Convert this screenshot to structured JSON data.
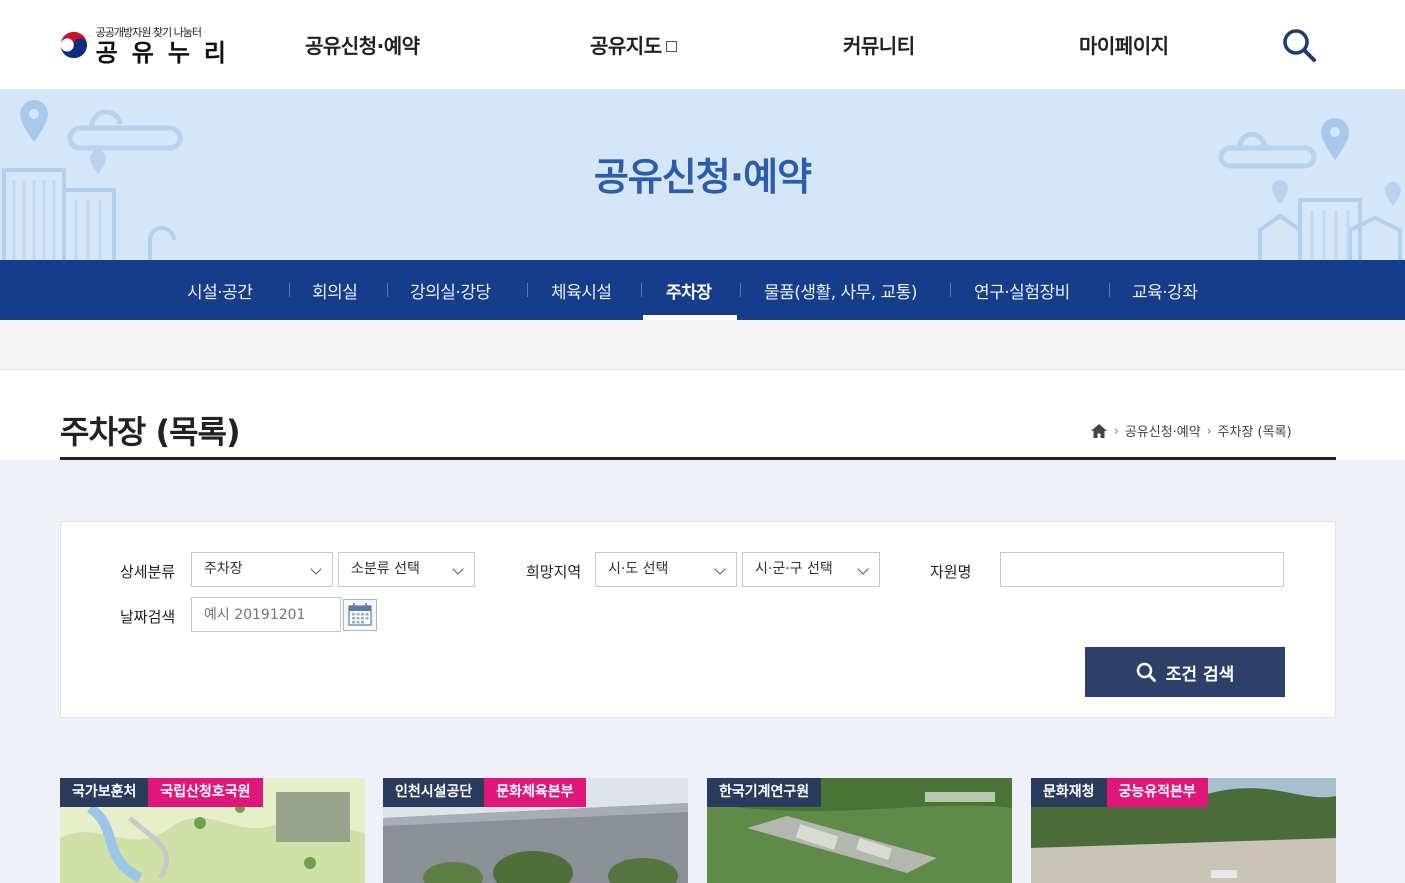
{
  "header": {
    "logo_sub": "공공개방자원 찾기 나눔터",
    "logo_main": "공유누리",
    "nav": [
      "공유신청·예약",
      "공유지도",
      "커뮤니티",
      "마이페이지"
    ]
  },
  "banner": {
    "title": "공유신청·예약"
  },
  "subnav": {
    "items": [
      "시설·공간",
      "회의실",
      "강의실·강당",
      "체육시설",
      "주차장",
      "물품(생활, 사무, 교통)",
      "연구·실험장비",
      "교육·강좌"
    ],
    "active": "주차장"
  },
  "page": {
    "title": "주차장 (목록)",
    "breadcrumb": [
      "공유신청·예약",
      "주차장 (목록)"
    ]
  },
  "search": {
    "detail_label": "상세분류",
    "category_value": "주차장",
    "subcategory_value": "소분류 선택",
    "region_label": "희망지역",
    "sido_value": "시·도 선택",
    "sigungu_value": "시·군·구 선택",
    "resource_label": "자원명",
    "resource_value": "",
    "date_label": "날짜검색",
    "date_placeholder": "예시 20191201",
    "submit_label": "조건 검색"
  },
  "cards": [
    {
      "tags": [
        "국가보훈처",
        "국립산청호국원"
      ]
    },
    {
      "tags": [
        "인천시설공단",
        "문화체육본부"
      ]
    },
    {
      "tags": [
        "한국기계연구원"
      ]
    },
    {
      "tags": [
        "문화재청",
        "궁능유적본부"
      ]
    }
  ],
  "colors": {
    "primary": "#163d8a",
    "banner": "#d4e6f8",
    "accent": "#e0177a",
    "button": "#2e4068"
  }
}
